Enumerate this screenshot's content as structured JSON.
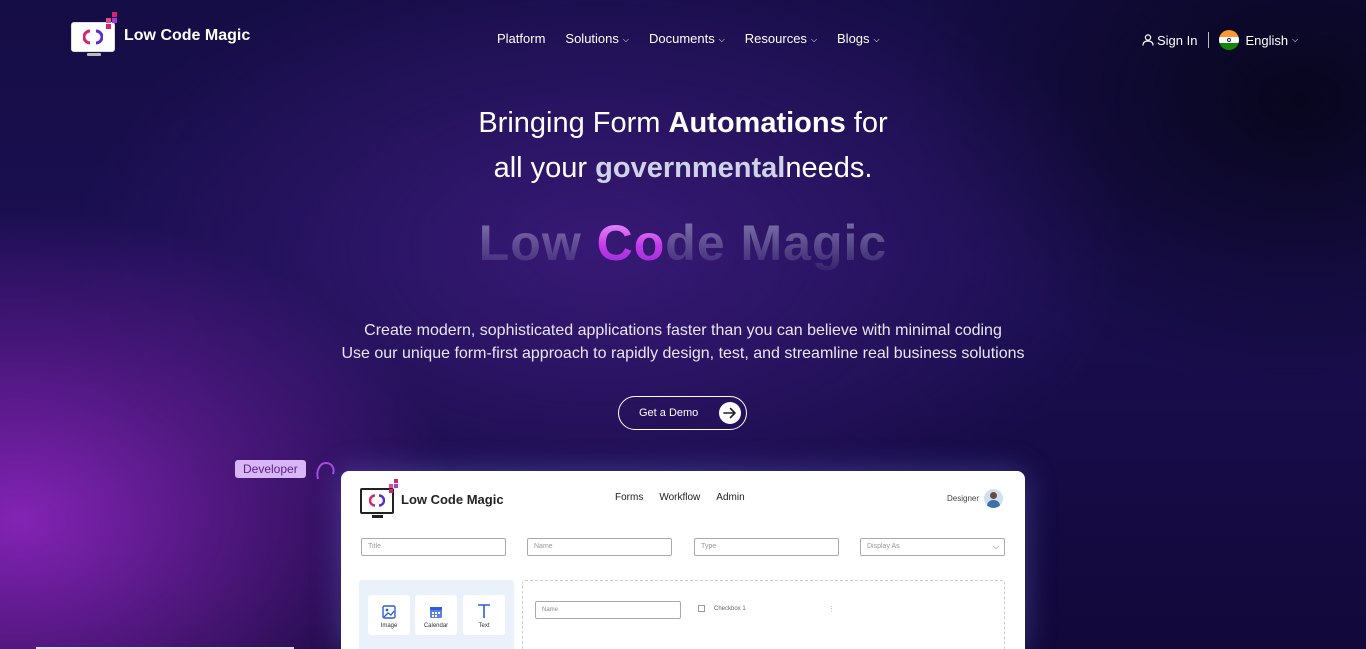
{
  "brand": {
    "name": "Low Code Magic"
  },
  "nav": {
    "items": [
      {
        "label": "Platform",
        "has_dropdown": false
      },
      {
        "label": "Solutions",
        "has_dropdown": true
      },
      {
        "label": "Documents",
        "has_dropdown": true
      },
      {
        "label": "Resources",
        "has_dropdown": true
      },
      {
        "label": "Blogs",
        "has_dropdown": true
      }
    ],
    "sign_in": "Sign In",
    "language": "English"
  },
  "hero": {
    "line1_pre": "Bringing Form ",
    "line1_bold": "Automations",
    "line1_post": " for",
    "line2_pre": "all your ",
    "line2_animated": "governmental",
    "line2_post": "needs.",
    "brand_big_part1": "Low ",
    "brand_big_highlight": "Co",
    "brand_big_part2": "de Magic",
    "subtitle_1": "Create modern, sophisticated applications faster than you can believe with minimal coding",
    "subtitle_2": "Use our unique form-first approach to rapidly design, test, and streamline real business solutions",
    "cta": "Get a Demo"
  },
  "badge": "Developer",
  "preview": {
    "brand": "Low Code Magic",
    "menu": [
      "Forms",
      "Workflow",
      "Admin"
    ],
    "user_label": "Designer",
    "fields": [
      {
        "placeholder": "Title"
      },
      {
        "placeholder": "Name"
      },
      {
        "placeholder": "Type"
      },
      {
        "placeholder": "Display As"
      }
    ],
    "tools": [
      {
        "label": "Image",
        "icon": "image-icon"
      },
      {
        "label": "Calendar",
        "icon": "calendar-icon"
      },
      {
        "label": "Text",
        "icon": "text-icon"
      }
    ],
    "canvas_field": "Name",
    "canvas_checkbox": "Checkbox 1"
  },
  "colors": {
    "accent": "#c43ae8",
    "badge_bg": "#d9b6f5",
    "badge_text": "#5b1f8a"
  }
}
